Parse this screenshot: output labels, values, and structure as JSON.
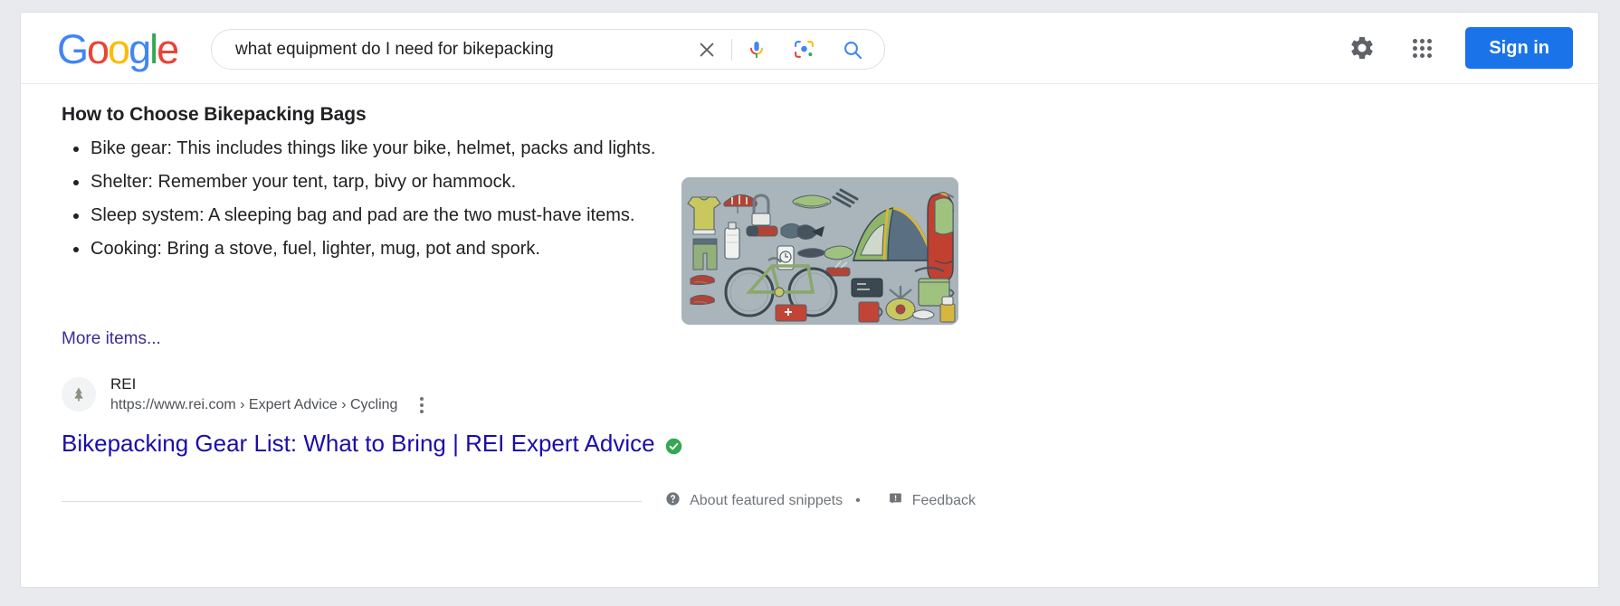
{
  "header": {
    "logo_letters": [
      "G",
      "o",
      "o",
      "g",
      "l",
      "e"
    ],
    "logo_name": "google-logo",
    "search": {
      "value": "what equipment do I need for bikepacking",
      "placeholder": "Search",
      "clear_icon": "close-icon",
      "mic_icon": "microphone-icon",
      "lens_icon": "google-lens-icon",
      "search_icon": "search-icon"
    },
    "settings_icon": "gear-icon",
    "apps_icon": "apps-grid-icon",
    "sign_in_label": "Sign in",
    "accent_color": "#1a73e8"
  },
  "snippet": {
    "title": "How to Choose Bikepacking Bags",
    "bullets": [
      "Bike gear: This includes things like your bike, helmet, packs and lights.",
      "Shelter: Remember your tent, tarp, bivy or hammock.",
      "Sleep system: A sleeping bag and pad are the two must-have items.",
      "Cooking: Bring a stove, fuel, lighter, mug, pot and spork."
    ],
    "more_items_label": "More items...",
    "more_items_color": "#3c2d91",
    "thumbnail_name": "bikepacking-gear-illustration",
    "thumbnail_alt": "Illustration of bikepacking gear: tent, bike, sleeping bag, clothing, stove and cookware"
  },
  "result": {
    "site_name": "REI",
    "favicon_name": "rei-tree-favicon",
    "url": "https://www.rei.com › Expert Advice › Cycling",
    "kebab_icon": "more-options-icon",
    "title": "Bikepacking Gear List: What to Bring | REI Expert Advice",
    "title_color": "#1a0dab",
    "verified_icon": "verified-check-icon",
    "verified_color": "#34a853"
  },
  "footer": {
    "about_icon": "help-circle-icon",
    "about_label": "About featured snippets",
    "separator": "•",
    "feedback_icon": "feedback-flag-icon",
    "feedback_label": "Feedback"
  }
}
